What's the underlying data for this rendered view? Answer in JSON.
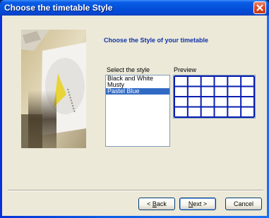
{
  "window": {
    "title": "Choose the timetable Style",
    "close_icon": "close-icon"
  },
  "main": {
    "heading": "Choose the Style of your timetable",
    "select_label": "Select the style",
    "preview_label": "Preview",
    "styles": [
      "Black and White",
      "Musty",
      "Pastel Blue"
    ],
    "selected_style": "Pastel Blue",
    "preview_grid": {
      "rows": 4,
      "cols": 6,
      "line_color": "#0a1fb0"
    }
  },
  "buttons": {
    "back_accesskey": "B",
    "back_rest": "ack",
    "back_prefix": "< ",
    "next_accesskey": "N",
    "next_rest": "ext >",
    "cancel": "Cancel"
  },
  "colors": {
    "accent": "#1033a8",
    "selection": "#316ac5",
    "titlebar": "#0451d8"
  }
}
